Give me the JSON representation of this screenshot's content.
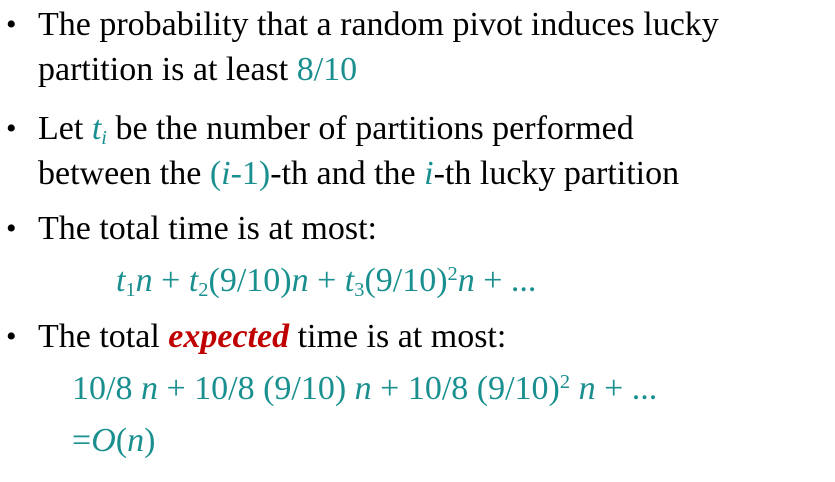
{
  "bullets": [
    {
      "line1": "The probability that a random pivot induces lucky",
      "line2_prefix": "partition is at least ",
      "line2_value": "8/10"
    },
    {
      "let": "Let ",
      "t": "t",
      "i_sub": "i",
      "rest1": " be the number of partitions performed",
      "between": "between the ",
      "open": "(",
      "i1": "i",
      "minus1": "-1)",
      "th_and": "-th and the ",
      "i2": "i",
      "rest2": "-th lucky partition"
    },
    {
      "line1": "The total time is at most:"
    },
    {
      "prefix": "The total ",
      "emph": "expected",
      "suffix": " time is at most:"
    }
  ],
  "formula1": {
    "t1": "t",
    "s1": "1",
    "n1": "n",
    "plus1": " + ",
    "t2": "t",
    "s2": "2",
    "frac2": "(9/10)",
    "n2": "n",
    "plus2": " + ",
    "t3": "t",
    "s3": "3",
    "frac3": "(9/10)",
    "pow3": "2",
    "n3": "n",
    "tail": " + ..."
  },
  "formula2": {
    "a": "10/8 ",
    "n1": "n",
    "b": " + 10/8 (9/10) ",
    "n2": "n",
    "c": " + 10/8 (9/10)",
    "pow": "2",
    "d": " ",
    "n3": "n",
    "tail": " + ..."
  },
  "formula3": {
    "eq": "=",
    "O": "O",
    "open": "(",
    "n": "n",
    "close": ")"
  },
  "colors": {
    "teal": "#1a8f8f",
    "red": "#c00000",
    "text": "#000000"
  }
}
